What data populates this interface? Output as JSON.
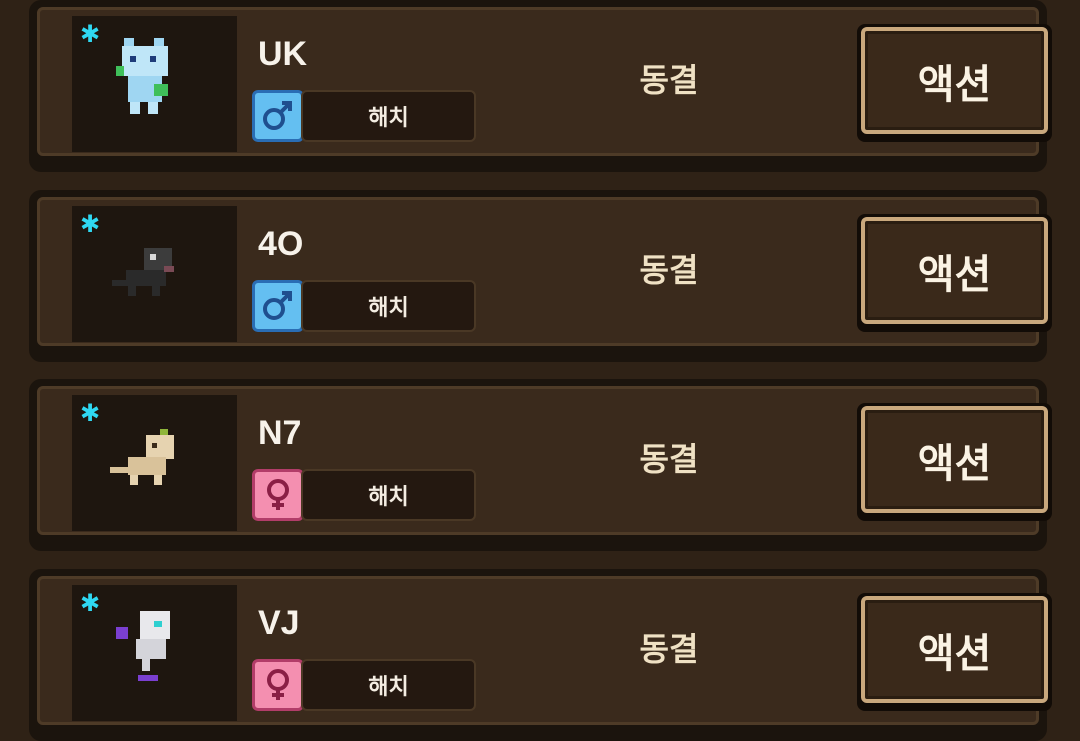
{
  "colors": {
    "background": "#2f2216",
    "accent_star": "#2fd8f2",
    "male": "#64bff1",
    "female": "#f48fb0"
  },
  "creatures": [
    {
      "name": "UK",
      "gender": "male",
      "gender_symbol": "♂",
      "trait": "해치",
      "status": "동결",
      "action_label": "액션",
      "starred": "✱",
      "sprite": "blue-cat-sprite"
    },
    {
      "name": "4O",
      "gender": "male",
      "gender_symbol": "♂",
      "trait": "해치",
      "status": "동결",
      "action_label": "액션",
      "starred": "✱",
      "sprite": "black-rat-sprite"
    },
    {
      "name": "N7",
      "gender": "female",
      "gender_symbol": "♀",
      "trait": "해치",
      "status": "동결",
      "action_label": "액션",
      "starred": "✱",
      "sprite": "tan-cat-sprite"
    },
    {
      "name": "VJ",
      "gender": "female",
      "gender_symbol": "♀",
      "trait": "해치",
      "status": "동결",
      "action_label": "액션",
      "starred": "✱",
      "sprite": "white-cat-sprite"
    }
  ]
}
